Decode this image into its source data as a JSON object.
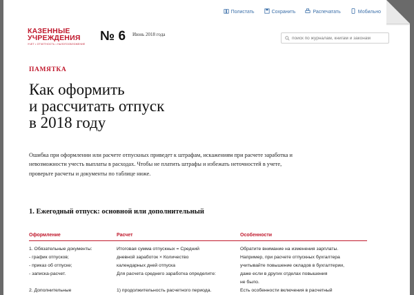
{
  "toolbar": {
    "items": [
      {
        "label": "Полистать",
        "icon": "book-icon"
      },
      {
        "label": "Сохранить",
        "icon": "save-icon"
      },
      {
        "label": "Распечатать",
        "icon": "print-icon"
      },
      {
        "label": "Мобильно",
        "icon": "mobile-icon"
      }
    ]
  },
  "brand": {
    "line1": "КАЗЕННЫЕ",
    "line2": "УЧРЕЖДЕНИЯ",
    "tagline": "УЧЕТ • ОТЧЕТНОСТЬ • НАЛОГООБЛОЖЕНИЕ"
  },
  "issue": {
    "number": "№ 6",
    "date": "Июнь 2018 года"
  },
  "search": {
    "placeholder": "поиск по журналам, книгам и законам"
  },
  "article": {
    "kicker": "ПАМЯТКА",
    "title_lines": [
      "Как оформить",
      "и рассчитать отпуск",
      "в 2018 году"
    ],
    "lead": "Ошибка при оформлении или расчете отпускных приведет к штрафам, искажениям при расчете заработка и невозможности учесть выплаты в расходах. Чтобы не платить штрафы и избежать неточностей в учете, проверьте расчеты и документы по таблице ниже.",
    "section_title": "1. Ежегодный отпуск: основной или дополнительный"
  },
  "table": {
    "headers": [
      "Оформление",
      "Расчет",
      "Особенности"
    ],
    "col1": [
      "1. Обязательные документы:",
      "- график отпусков;",
      "- приказ об отпуске;",
      "- записка-расчет.",
      "",
      "2. Дополнительные"
    ],
    "col2": [
      "Итоговая сумма отпускных = Средний",
      "дневной заработок × Количество",
      "календарных дней отпуска",
      "Для расчета среднего заработка определите:",
      "",
      "1) продолжительность расчетного периода."
    ],
    "col3": [
      "Обратите внимание на изменения зарплаты.",
      "Например, при расчете отпускных бухгалтера",
      "учитывайте повышение окладов в бухгалтерии,",
      "даже если в других отделах повышения",
      "не было.",
      "Есть особенности включения в расчетный"
    ]
  },
  "colors": {
    "accent": "#c0182c",
    "link": "#3a6ea8"
  }
}
